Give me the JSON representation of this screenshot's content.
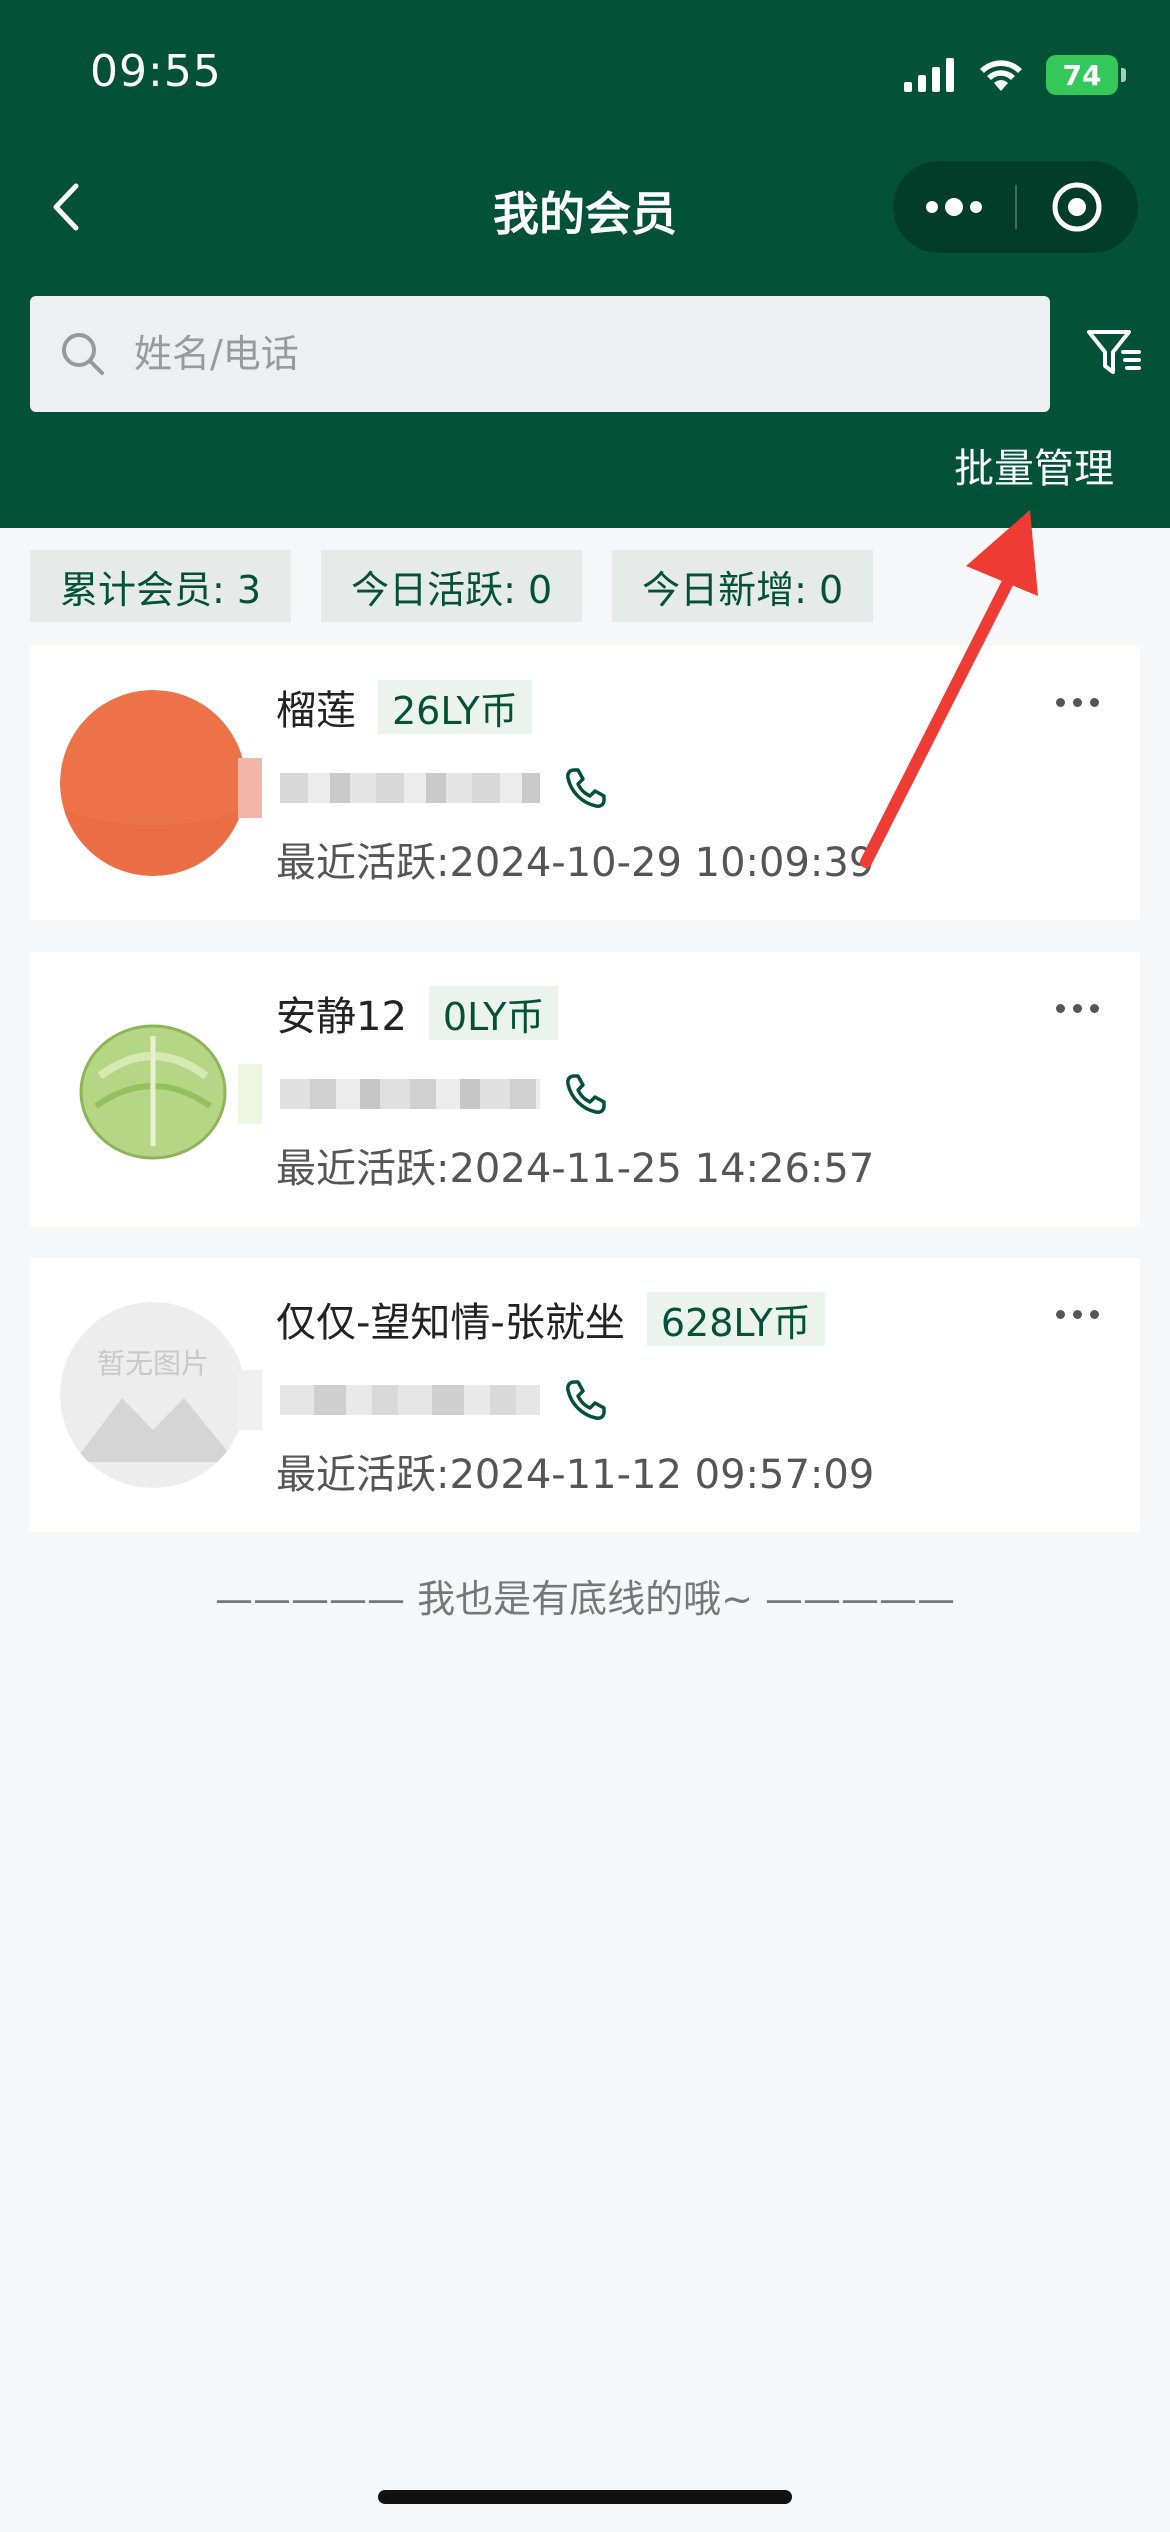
{
  "status_bar": {
    "time": "09:55",
    "battery": "74"
  },
  "nav": {
    "title": "我的会员"
  },
  "search": {
    "placeholder": "姓名/电话"
  },
  "actions": {
    "batch_manage": "批量管理"
  },
  "stats": [
    {
      "label": "累计会员: 3"
    },
    {
      "label": "今日活跃: 0"
    },
    {
      "label": "今日新增: 0"
    }
  ],
  "members": [
    {
      "name": "榴莲",
      "coins": "26LY币",
      "last_active": "最近活跃:2024-10-29 10:09:39",
      "avatar": "orange-circle"
    },
    {
      "name": "安静12",
      "coins": "0LY币",
      "last_active": "最近活跃:2024-11-25 14:26:57",
      "avatar": "cabbage"
    },
    {
      "name": "仅仅-望知情-张就坐",
      "coins": "628LY币",
      "last_active": "最近活跃:2024-11-12 09:57:09",
      "avatar": "placeholder"
    }
  ],
  "placeholder_avatar_text": "暂无图片",
  "footer": {
    "text": "————— 我也是有底线的哦~ —————"
  },
  "colors": {
    "primary": "#035238",
    "arrow": "#ee3b34",
    "battery": "#34c759"
  }
}
